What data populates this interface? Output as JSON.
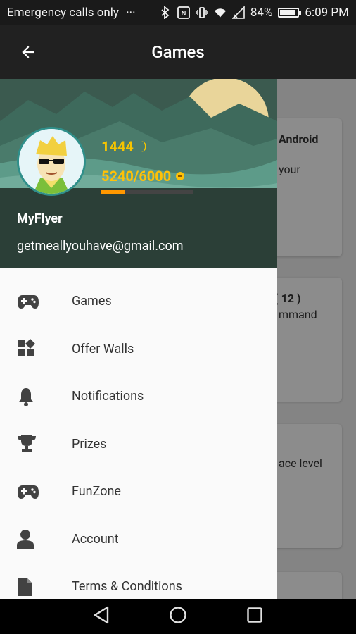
{
  "status_bar": {
    "carrier": "Emergency calls only",
    "overflow": "···",
    "battery": "84%",
    "time": "6:09 PM"
  },
  "app_bar": {
    "title": "Games"
  },
  "background_cards": [
    {
      "text_1": "Android",
      "text_2": "your"
    },
    {
      "text_1": "( 12 )",
      "text_2": "mmand"
    },
    {
      "text_1": "ace level"
    }
  ],
  "profile": {
    "coins": "1444",
    "xp": "5240/6000",
    "xp_progress": 0.25,
    "username": "MyFlyer",
    "email": "getmeallyouhave@gmail.com"
  },
  "menu": [
    {
      "label": "Games",
      "icon": "gamepad-icon"
    },
    {
      "label": "Offer Walls",
      "icon": "widgets-icon"
    },
    {
      "label": "Notifications",
      "icon": "bell-icon"
    },
    {
      "label": "Prizes",
      "icon": "trophy-icon"
    },
    {
      "label": "FunZone",
      "icon": "gamepad-icon"
    },
    {
      "label": "Account",
      "icon": "person-icon"
    },
    {
      "label": "Terms & Conditions",
      "icon": "document-icon"
    }
  ],
  "colors": {
    "header_bg": "#2b3f37",
    "coin": "#f5c400",
    "xp_fill": "#ff9800",
    "icon": "#424242"
  }
}
